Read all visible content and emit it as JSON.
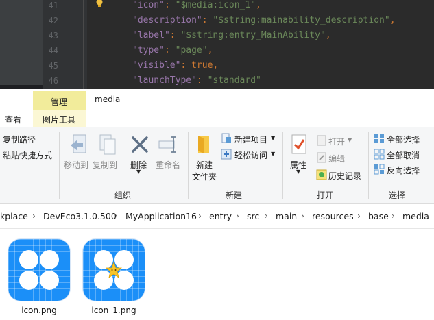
{
  "editor": {
    "lines": [
      {
        "num": "41",
        "key": "\"icon\"",
        "value": "\"$media:icon_1\"",
        "trail": ","
      },
      {
        "num": "42",
        "key": "\"description\"",
        "value": "\"$string:mainability_description\"",
        "trail": ","
      },
      {
        "num": "43",
        "key": "\"label\"",
        "value": "\"$string:entry_MainAbility\"",
        "trail": ","
      },
      {
        "num": "44",
        "key": "\"type\"",
        "value": "\"page\"",
        "trail": ","
      },
      {
        "num": "45",
        "key": "\"visible\"",
        "value": "true",
        "trail": ","
      },
      {
        "num": "46",
        "key": "\"launchType\"",
        "value": "\"standard\"",
        "trail": ""
      }
    ],
    "colors": {
      "background": "#2b2b2b",
      "key": "#9876aa",
      "string": "#6a8759",
      "keyword": "#cc7832"
    }
  },
  "ribbon_tabs": {
    "manage": "管理",
    "media": "media",
    "view": "查看",
    "picture_tools": "图片工具",
    "highlight_color": "#f2ec9b"
  },
  "ribbon": {
    "clipboard": {
      "copy_path": "复制路径",
      "paste_shortcut": "粘贴快捷方式"
    },
    "organize": {
      "move_to": "移动到",
      "copy_to": "复制到",
      "delete": "删除",
      "rename": "重命名",
      "group_label": "组织"
    },
    "new": {
      "new_folder": "新建\n文件夹",
      "new_folder_line1": "新建",
      "new_folder_line2": "文件夹",
      "new_item": "新建项目",
      "easy_access": "轻松访问",
      "group_label": "新建"
    },
    "open": {
      "properties": "属性",
      "open": "打开",
      "edit": "编辑",
      "history": "历史记录",
      "group_label": "打开"
    },
    "select": {
      "select_all": "全部选择",
      "select_none": "全部取消",
      "invert": "反向选择",
      "group_label": "选择"
    }
  },
  "address_bar": {
    "crumbs": [
      "kplace",
      "DevEco3.1.0.500",
      "MyApplication16",
      "entry",
      "src",
      "main",
      "resources",
      "base",
      "media"
    ]
  },
  "files": [
    {
      "name": "icon.png",
      "icon": "blue-flower-app-icon"
    },
    {
      "name": "icon_1.png",
      "icon": "blue-flower-star-app-icon"
    }
  ]
}
